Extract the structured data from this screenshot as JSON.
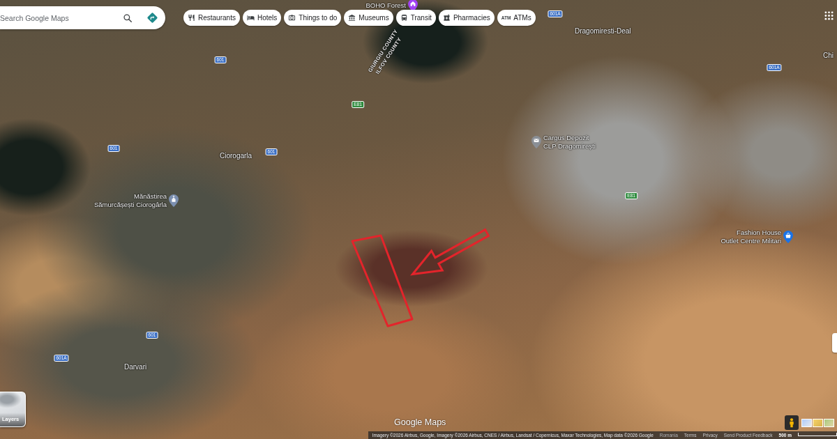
{
  "search": {
    "placeholder": "Search Google Maps"
  },
  "categories": [
    {
      "label": "Restaurants",
      "kind": "restaurants"
    },
    {
      "label": "Hotels",
      "kind": "hotels"
    },
    {
      "label": "Things to do",
      "kind": "things"
    },
    {
      "label": "Museums",
      "kind": "museums"
    },
    {
      "label": "Transit",
      "kind": "transit"
    },
    {
      "label": "Pharmacies",
      "kind": "pharmacies"
    },
    {
      "label": "ATMs",
      "kind": "atms",
      "icon_label": "ATM"
    }
  ],
  "county_border": {
    "labels": [
      "GIURGIU COUNTY",
      "ILFOV COUNTY"
    ]
  },
  "places": [
    {
      "lines": [
        "BOHO Forest"
      ],
      "kind": "house",
      "color": "#a142f4"
    },
    {
      "lines": [
        "Dragomiresti-Deal"
      ],
      "kind": "town"
    },
    {
      "lines": [
        "Chi"
      ],
      "kind": "town"
    },
    {
      "lines": [
        "Ciorogarla"
      ],
      "kind": "town"
    },
    {
      "lines": [
        "Mănăstirea",
        "Sămurcășești Ciorogârla"
      ],
      "kind": "church",
      "color": "#7b8fb0"
    },
    {
      "lines": [
        "Cargus Depozit",
        "CLP Dragomirești"
      ],
      "kind": "envelope",
      "color": "#8a8f96"
    },
    {
      "lines": [
        "Fashion House",
        "Outlet Centre Militari"
      ],
      "kind": "bag",
      "color": "#1a73e8"
    },
    {
      "lines": [
        "Darvari"
      ],
      "kind": "town"
    }
  ],
  "road_shields": [
    {
      "label": "601A",
      "kind": "national"
    },
    {
      "label": "601",
      "kind": "national"
    },
    {
      "label": "E81",
      "kind": "european"
    },
    {
      "label": "601",
      "kind": "national"
    },
    {
      "label": "601",
      "kind": "national"
    },
    {
      "label": "E81",
      "kind": "european"
    },
    {
      "label": "601A",
      "kind": "national"
    },
    {
      "label": "601",
      "kind": "national"
    },
    {
      "label": "601A",
      "kind": "national"
    }
  ],
  "markup": [
    {
      "kind": "outline"
    },
    {
      "kind": "arrow"
    }
  ],
  "layers_button": {
    "label": "Layers"
  },
  "logo": "Google Maps",
  "footer": {
    "attribution": "Imagery ©2026 Airbus, Google, Imagery ©2026 Airbus, CNES / Airbus, Landsat / Copernicus, Maxar Technologies, Map data ©2026 Google",
    "links": [
      {
        "label": "Romania",
        "kind": "region"
      },
      {
        "label": "Terms",
        "kind": "link"
      },
      {
        "label": "Privacy",
        "kind": "link"
      },
      {
        "label": "Send Product Feedback",
        "kind": "link"
      }
    ],
    "scale": "500 m"
  }
}
